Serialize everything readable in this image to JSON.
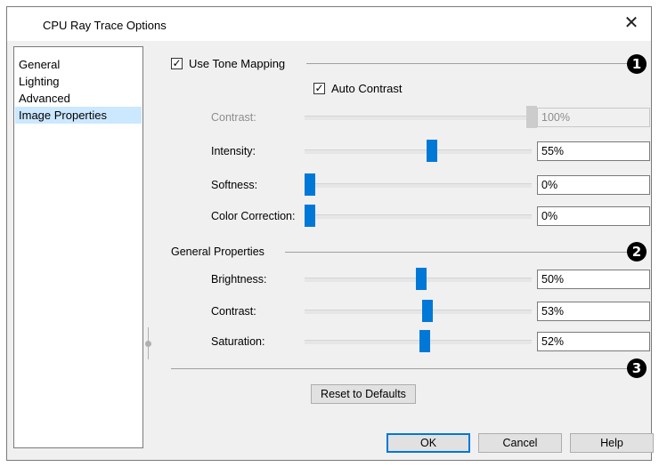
{
  "dialog": {
    "title": "CPU Ray Trace Options",
    "close_glyph": "✕"
  },
  "nav": {
    "items": [
      {
        "label": "General"
      },
      {
        "label": "Lighting"
      },
      {
        "label": "Advanced"
      },
      {
        "label": "Image Properties"
      }
    ],
    "selected": "Image Properties"
  },
  "tone_mapping": {
    "checkbox_label": "Use Tone Mapping",
    "checked": true,
    "marker": "1",
    "auto_contrast_label": "Auto Contrast",
    "auto_contrast_checked": true,
    "rows": [
      {
        "label": "Contrast:",
        "value": "100%",
        "level": 1.0,
        "disabled": true
      },
      {
        "label": "Intensity:",
        "value": "55%",
        "level": 0.55,
        "disabled": false
      },
      {
        "label": "Softness:",
        "value": "0%",
        "level": 0.0,
        "disabled": false
      },
      {
        "label": "Color Correction:",
        "value": "0%",
        "level": 0.0,
        "disabled": false
      }
    ]
  },
  "general_properties": {
    "label": "General Properties",
    "marker": "2",
    "rows": [
      {
        "label": "Brightness:",
        "value": "50%",
        "level": 0.5
      },
      {
        "label": "Contrast:",
        "value": "53%",
        "level": 0.53
      },
      {
        "label": "Saturation:",
        "value": "52%",
        "level": 0.52
      }
    ]
  },
  "reset": {
    "marker": "3",
    "button_label": "Reset to Defaults"
  },
  "footer": {
    "ok_label": "OK",
    "cancel_label": "Cancel",
    "help_label": "Help"
  },
  "colors": {
    "accent": "#0078d7",
    "selection": "#cce8ff"
  }
}
